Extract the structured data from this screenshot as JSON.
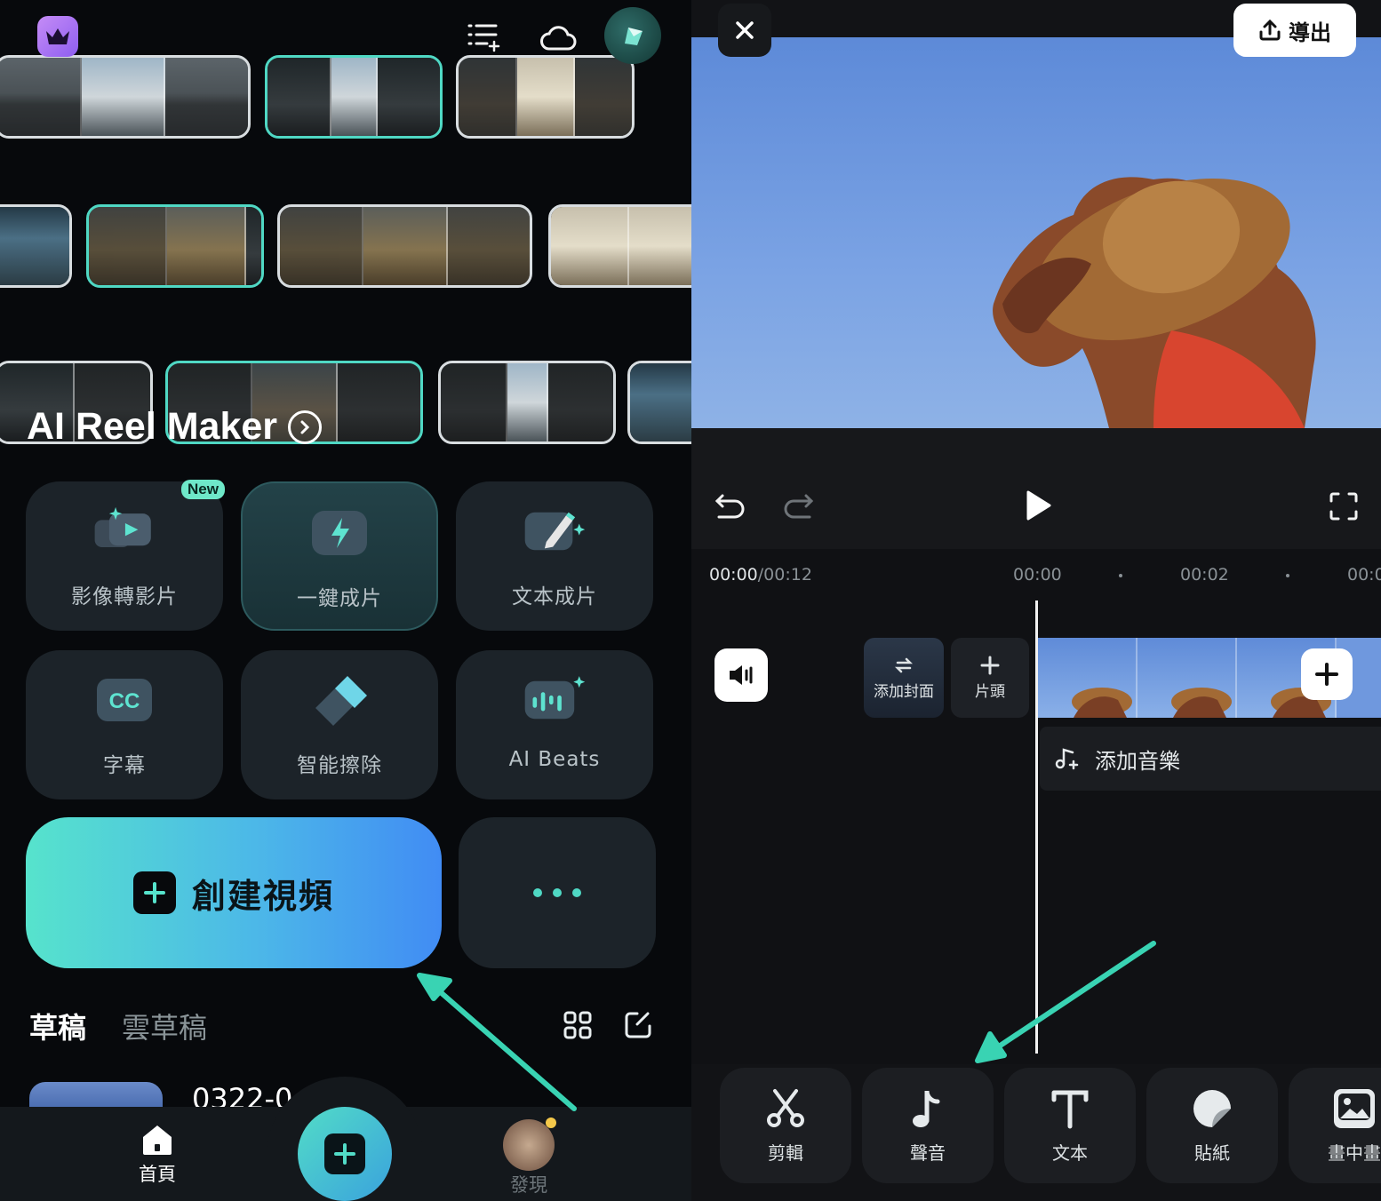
{
  "left": {
    "banner": {
      "title": "AI Reel Maker"
    },
    "tools": [
      {
        "label": "影像轉影片",
        "icon": "photo-to-video-icon",
        "badge": "New"
      },
      {
        "label": "一鍵成片",
        "icon": "lightning-icon"
      },
      {
        "label": "文本成片",
        "icon": "pencil-sparkle-icon"
      },
      {
        "label": "字幕",
        "icon": "cc-icon",
        "icon_text": "CC"
      },
      {
        "label": "智能擦除",
        "icon": "eraser-icon"
      },
      {
        "label": "AI Beats",
        "icon": "music-beats-icon"
      }
    ],
    "create_button": {
      "label": "創建視頻"
    },
    "drafts": {
      "tabs": [
        "草稿",
        "雲草稿"
      ],
      "items": [
        {
          "name": "0322-0"
        }
      ]
    },
    "nav": {
      "home": "首頁",
      "discover": "發現"
    },
    "colors": {
      "accent": "#4fd8c4",
      "create_gradient_start": "#56e3cc",
      "create_gradient_end": "#418cf4"
    }
  },
  "right": {
    "export_label": "導出",
    "time": {
      "current": "00:00",
      "total": "/00:12"
    },
    "ticks": [
      "00:00",
      "00:02",
      "00:0"
    ],
    "timeline": {
      "cover_label": "添加封面",
      "intro_label": "片頭",
      "music_label": "添加音樂"
    },
    "toolbar": [
      {
        "label": "剪輯",
        "icon": "scissors-icon"
      },
      {
        "label": "聲音",
        "icon": "music-note-icon"
      },
      {
        "label": "文本",
        "icon": "text-icon"
      },
      {
        "label": "貼紙",
        "icon": "sticker-icon"
      },
      {
        "label": "畫中畫",
        "icon": "picture-in-picture-icon"
      }
    ]
  }
}
